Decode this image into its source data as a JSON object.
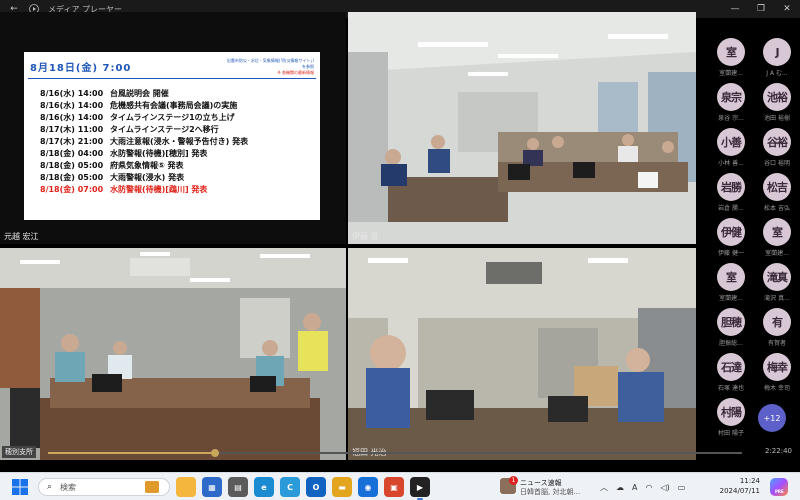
{
  "window": {
    "title": "メディア プレーヤー"
  },
  "slide": {
    "date": "8月18日(金) 7:00",
    "source_lines": [
      "出雲市防災・水位・気象情報(「防災情報サイト」)",
      "を参照"
    ],
    "source_note": "※ 各機関の最新情報",
    "rows": [
      {
        "time": "8/16(水) 14:00",
        "text": "台風説明会 開催",
        "highlight": false
      },
      {
        "time": "8/16(水) 14:00",
        "text": "危機感共有会議(事務局会議)の実施",
        "highlight": false
      },
      {
        "time": "8/16(水) 14:00",
        "text": "タイムラインステージ1の立ち上げ",
        "highlight": false
      },
      {
        "time": "8/17(木) 11:00",
        "text": "タイムラインステージ2へ移行",
        "highlight": false
      },
      {
        "time": "8/17(木) 21:00",
        "text": "大雨注意報(浸水・警報予告付き) 発表",
        "highlight": false
      },
      {
        "time": "8/18(金) 04:00",
        "text": "水防警報(待機)[穂別] 発表",
        "highlight": false
      },
      {
        "time": "8/18(金) 05:00",
        "text": "府県気象情報⑤ 発表",
        "highlight": false
      },
      {
        "time": "8/18(金) 05:00",
        "text": "大雨警報(浸水) 発表",
        "highlight": false
      },
      {
        "time": "8/18(金) 07:00",
        "text": "水防警報(待機)[鵡川] 発表",
        "highlight": true
      }
    ],
    "highlight_color": "#e0251b",
    "caption": "元越 宏江"
  },
  "tiles": {
    "top_right_caption": "伊藤 喜",
    "bottom_left_caption": "穂別支所",
    "bottom_right_caption": "福田 光治"
  },
  "participants": [
    {
      "initials": "室",
      "name": "室蘭建..."
    },
    {
      "initials": "J",
      "name": "J A む..."
    },
    {
      "initials": "泉宗",
      "name": "泉谷 宗..."
    },
    {
      "initials": "池裕",
      "name": "池田 裕樹"
    },
    {
      "initials": "小善",
      "name": "小林 善..."
    },
    {
      "initials": "谷裕",
      "name": "谷口 裕明"
    },
    {
      "initials": "岩勝",
      "name": "岩倉 勝..."
    },
    {
      "initials": "松吉",
      "name": "松本 吉弘"
    },
    {
      "initials": "伊健",
      "name": "伊藤 健一"
    },
    {
      "initials": "室",
      "name": "室蘭建..."
    },
    {
      "initials": "室",
      "name": "室蘭建..."
    },
    {
      "initials": "滝真",
      "name": "滝沢 真..."
    },
    {
      "initials": "胆穂",
      "name": "胆振総..."
    },
    {
      "initials": "有",
      "name": "有賀者"
    },
    {
      "initials": "石達",
      "name": "石塚 達也"
    },
    {
      "initials": "梅幸",
      "name": "梅木 幸司"
    },
    {
      "initials": "村陽",
      "name": "村田 陽子"
    }
  ],
  "more_participants": "+12",
  "player": {
    "duration": "2:22:40",
    "progress": 0.24
  },
  "taskbar": {
    "search_placeholder": "検索",
    "news_title": "ニュース速報",
    "news_sub": "日韓首脳, 対北朝...",
    "news_badge": "1",
    "ime": "A",
    "time": "11:24",
    "date": "2024/07/11",
    "copilot_label": "PRE"
  }
}
